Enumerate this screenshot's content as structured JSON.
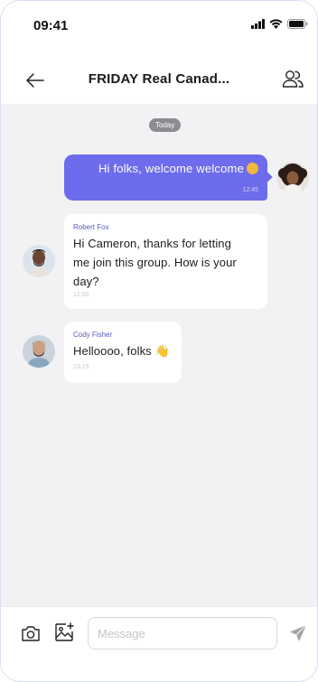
{
  "status_bar": {
    "time": "09:41"
  },
  "header": {
    "title": "FRIDAY Real Canad..."
  },
  "chat": {
    "date_label": "Today",
    "messages": [
      {
        "direction": "outgoing",
        "text": "Hi folks, welcome welcome",
        "time": "12:45"
      },
      {
        "direction": "incoming",
        "sender": "Robert Fox",
        "lines": [
          "Hi Cameron, thanks for letting",
          "me join this group. How is your",
          "day?"
        ],
        "time": "12:58"
      },
      {
        "direction": "incoming",
        "sender": "Cody Fisher",
        "text": "Helloooo, folks",
        "emoji": "👋",
        "time": "13:15"
      }
    ]
  },
  "composer": {
    "placeholder": "Message"
  },
  "colors": {
    "accent": "#6c6cec",
    "chat_bg": "#f2f2f4",
    "sender_name": "#5a58c8"
  }
}
